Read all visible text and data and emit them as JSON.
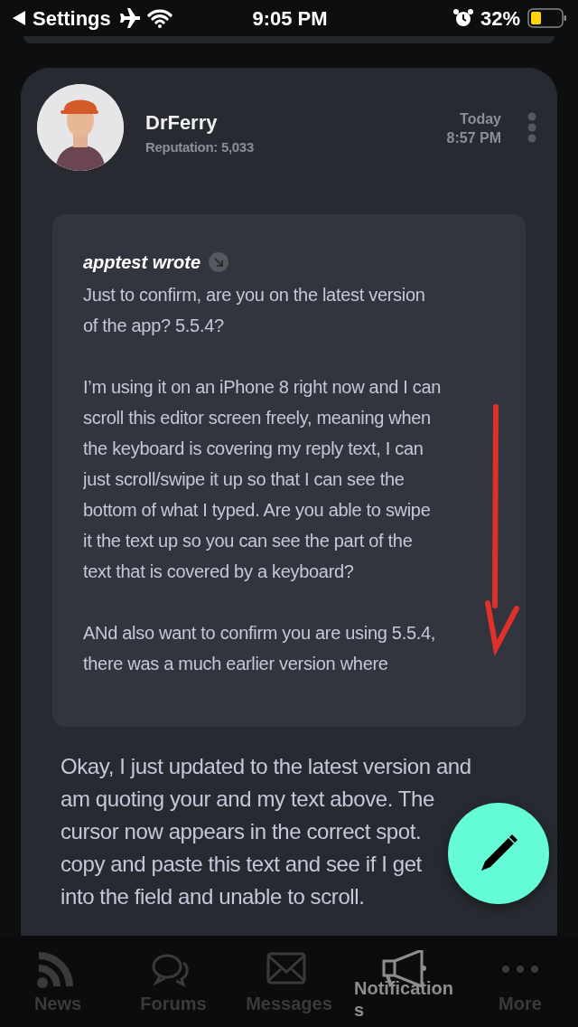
{
  "status_bar": {
    "back_label": "Settings",
    "time": "9:05 PM",
    "battery": "32%"
  },
  "post": {
    "author": "DrFerry",
    "reputation": "Reputation: 5,033",
    "date": "Today",
    "time": "8:57 PM",
    "quote": {
      "header": "apptest wrote",
      "paragraphs": [
        {
          "lines": [
            "Just to confirm, are you on the latest version",
            "of the app? 5.5.4?"
          ]
        },
        {
          "lines": [
            "I’m using it on an iPhone 8 right now and I can",
            "scroll this editor screen freely, meaning when",
            "the keyboard is covering my reply text, I can",
            "just scroll/swipe it up so that I can see the",
            "bottom of what I typed. Are you able to swipe",
            "it the text up so you can see the part of the",
            "text that is covered by a keyboard?"
          ]
        },
        {
          "lines": [
            "ANd also want to confirm you are using 5.5.4,",
            "there was a much earlier version where"
          ]
        }
      ]
    },
    "reply_lines": [
      "Okay, I just updated to the latest version and",
      "am quoting your and my text above. The",
      "cursor now appears in the correct spot.",
      "copy and paste this text and see if I get",
      "into the field and unable to scroll."
    ]
  },
  "tabs": [
    {
      "label": "News",
      "selected": false
    },
    {
      "label": "Forums",
      "selected": false
    },
    {
      "label": "Messages",
      "selected": false
    },
    {
      "label": "Notifications",
      "selected": true
    },
    {
      "label": "More",
      "selected": false
    }
  ]
}
